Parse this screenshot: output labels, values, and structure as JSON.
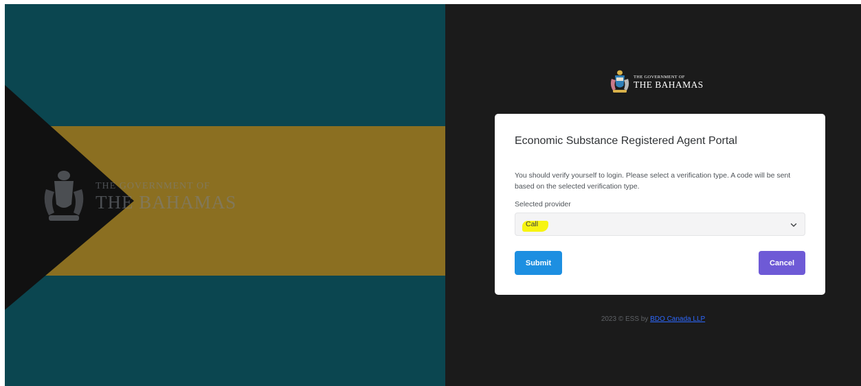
{
  "branding": {
    "gov_line": "THE GOVERNMENT OF",
    "country_line": "THE BAHAMAS"
  },
  "card": {
    "title": "Economic Substance Registered Agent Portal",
    "message": "You should verify yourself to login. Please select a verification type. A code will be sent based on the selected verification type.",
    "provider_label": "Selected provider",
    "provider_value": "Call",
    "submit_label": "Submit",
    "cancel_label": "Cancel"
  },
  "footer": {
    "prefix": "2023 © ESS by ",
    "link_text": "BDO Canada LLP"
  },
  "colors": {
    "flag_aquamarine": "#0b4650",
    "flag_gold": "#8b6f21",
    "flag_black": "#111111",
    "panel_dark": "#1b1b1b",
    "submit_blue": "#1d8fe1",
    "cancel_purple": "#6e5ad6",
    "highlight_yellow": "#f7f412"
  }
}
